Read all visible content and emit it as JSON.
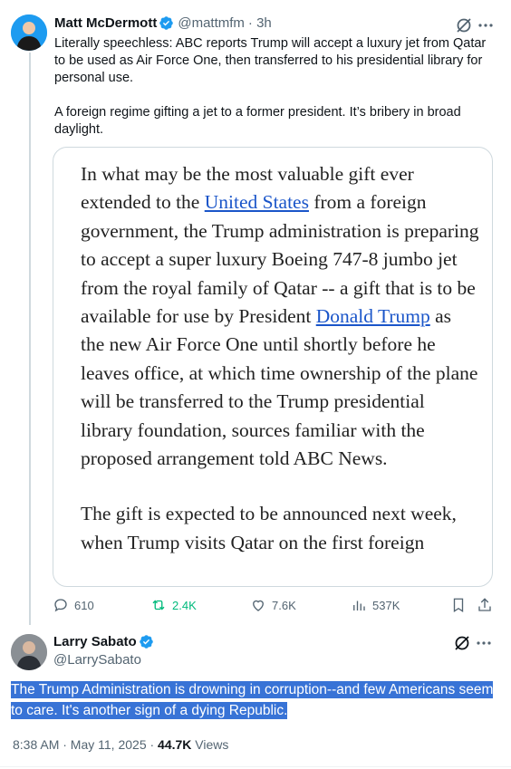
{
  "tweet1": {
    "name": "Matt McDermott",
    "handle": "@mattmfm",
    "time": "· 3h",
    "text_p1": "Literally speechless: ABC reports Trump will accept a luxury jet from Qatar to be used as Air Force One, then transferred to his presidential library for personal use.",
    "text_p2": "A foreign regime gifting a jet to a former president. It’s bribery in broad daylight.",
    "quote": {
      "p1_a": "In what may be the most valuable gift ever extended to the ",
      "link1": "United States",
      "p1_b": " from a foreign government, the Trump administration is preparing to accept a super luxury Boeing 747-8 jumbo jet from the royal family of Qatar -- a gift that is to be available for use by President ",
      "link2": "Donald Trump",
      "p1_c": " as the new Air Force One until shortly before he leaves office, at which time ownership of the plane will be transferred to the Trump presidential library foundation, sources familiar with the proposed arrangement told ABC News.",
      "p2": "The gift is expected to be announced next week, when Trump visits Qatar on the first foreign"
    },
    "actions": {
      "replies": "610",
      "reposts": "2.4K",
      "likes": "7.6K",
      "views": "537K"
    }
  },
  "tweet2": {
    "name": "Larry Sabato",
    "handle": "@LarrySabato",
    "text": "The Trump Administration is drowning in corruption--and few Americans seem to care. It's another sign of a dying Republic.",
    "timestamp": "8:38 AM · May 11, 2025 · ",
    "views_count": "44.7K",
    "views_label": " Views"
  },
  "colors": {
    "verified": "#1d9bf0",
    "repost_green": "#00ba7c",
    "selection": "#3873d6"
  }
}
